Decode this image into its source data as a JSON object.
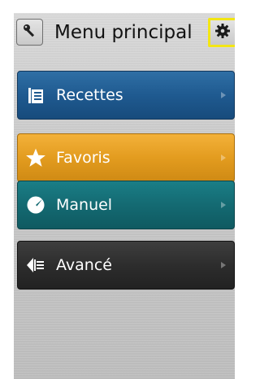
{
  "header": {
    "title": "Menu principal",
    "left_icon": "key-icon",
    "right_icon": "gear-icon",
    "highlight_color": "#f3e614"
  },
  "menu": {
    "items": [
      {
        "label": "Recettes",
        "icon": "book-list-icon",
        "color": "#1f5a90"
      },
      {
        "label": "Favoris",
        "icon": "star-icon",
        "color": "#e39c1f"
      },
      {
        "label": "Manuel",
        "icon": "dial-icon",
        "color": "#146a72"
      },
      {
        "label": "Avancé",
        "icon": "advanced-arrow-icon",
        "color": "#2d2d2d"
      }
    ]
  }
}
